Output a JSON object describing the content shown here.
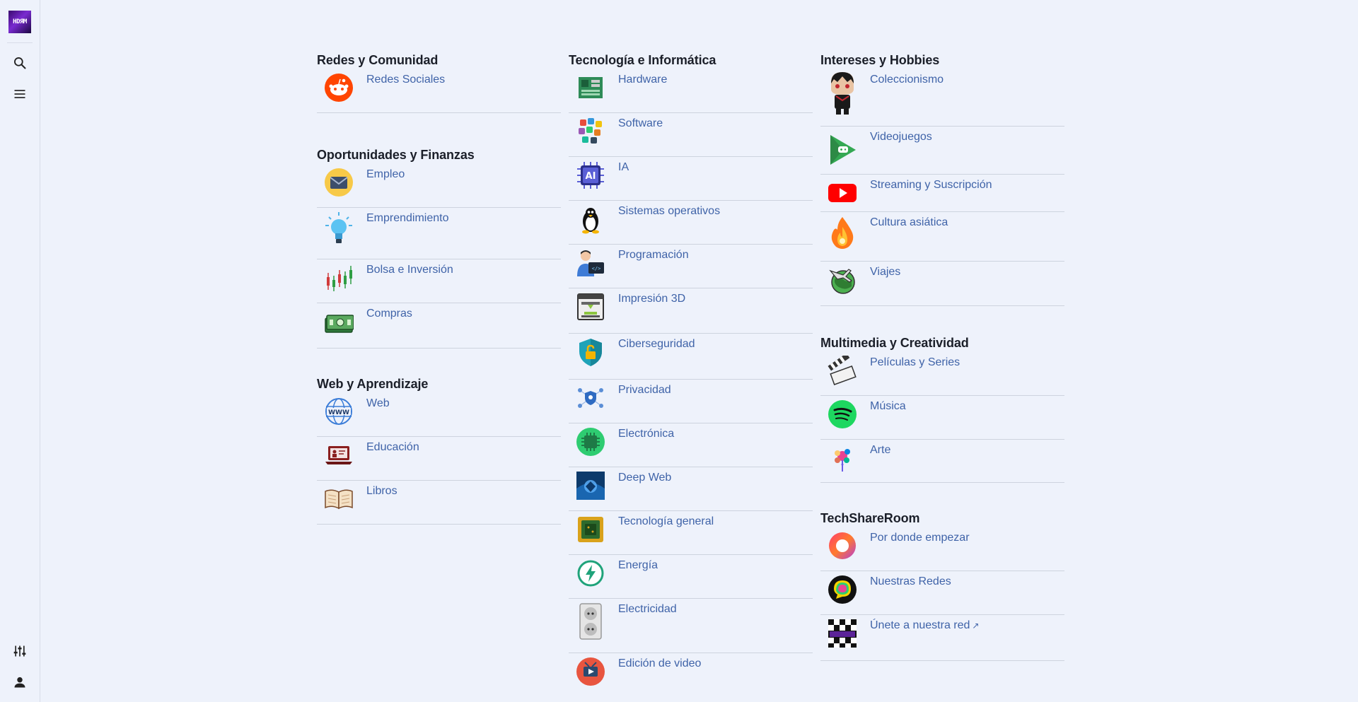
{
  "sidebar": {
    "logo_text": "HDЯM",
    "icons": [
      "search-icon",
      "menu-icon",
      "settings-sliders-icon",
      "user-icon"
    ]
  },
  "columns": [
    {
      "sections": [
        {
          "title": "Redes y Comunidad",
          "items": [
            {
              "label": "Redes Sociales",
              "icon": "reddit-icon"
            }
          ]
        },
        {
          "title": "Oportunidades y Finanzas",
          "items": [
            {
              "label": "Empleo",
              "icon": "mail-envelope-icon"
            },
            {
              "label": "Emprendimiento",
              "icon": "lightbulb-icon"
            },
            {
              "label": "Bolsa e Inversión",
              "icon": "candlestick-chart-icon"
            },
            {
              "label": "Compras",
              "icon": "money-bills-icon"
            }
          ]
        },
        {
          "title": "Web y Aprendizaje",
          "items": [
            {
              "label": "Web",
              "icon": "www-globe-icon"
            },
            {
              "label": "Educación",
              "icon": "laptop-teacher-icon"
            },
            {
              "label": "Libros",
              "icon": "open-book-icon"
            }
          ]
        }
      ]
    },
    {
      "sections": [
        {
          "title": "Tecnología e Informática",
          "items": [
            {
              "label": "Hardware",
              "icon": "motherboard-icon"
            },
            {
              "label": "Software",
              "icon": "app-blocks-icon"
            },
            {
              "label": "IA",
              "icon": "ai-chip-icon"
            },
            {
              "label": "Sistemas operativos",
              "icon": "linux-penguin-icon"
            },
            {
              "label": "Programación",
              "icon": "programmer-icon"
            },
            {
              "label": "Impresión 3D",
              "icon": "3d-printer-icon"
            },
            {
              "label": "Ciberseguridad",
              "icon": "shield-lock-icon"
            },
            {
              "label": "Privacidad",
              "icon": "privacy-network-icon"
            },
            {
              "label": "Electrónica",
              "icon": "microchip-icon"
            },
            {
              "label": "Deep Web",
              "icon": "deep-web-icon"
            },
            {
              "label": "Tecnología general",
              "icon": "circuit-chip-icon"
            },
            {
              "label": "Energía",
              "icon": "lightning-bolt-icon"
            },
            {
              "label": "Electricidad",
              "icon": "power-outlet-icon"
            },
            {
              "label": "Edición de video",
              "icon": "video-editing-icon"
            }
          ]
        }
      ]
    },
    {
      "sections": [
        {
          "title": "Intereses y Hobbies",
          "items": [
            {
              "label": "Coleccionismo",
              "icon": "funko-figure-icon"
            },
            {
              "label": "Videojuegos",
              "icon": "google-play-games-icon"
            },
            {
              "label": "Streaming y Suscripción",
              "icon": "youtube-icon"
            },
            {
              "label": "Cultura asiática",
              "icon": "fire-ball-icon"
            },
            {
              "label": "Viajes",
              "icon": "globe-airplane-icon"
            }
          ]
        },
        {
          "title": "Multimedia y Creatividad",
          "items": [
            {
              "label": "Películas y Series",
              "icon": "clapperboard-icon"
            },
            {
              "label": "Música",
              "icon": "spotify-icon"
            },
            {
              "label": "Arte",
              "icon": "paint-splash-icon"
            }
          ]
        },
        {
          "title": "TechShareRoom",
          "items": [
            {
              "label": "Por donde empezar",
              "icon": "start-ring-icon"
            },
            {
              "label": "Nuestras Redes",
              "icon": "chat-bubble-icon"
            },
            {
              "label": "Únete a nuestra red",
              "icon": "pixel-logo-icon",
              "external": true
            }
          ]
        }
      ]
    }
  ]
}
